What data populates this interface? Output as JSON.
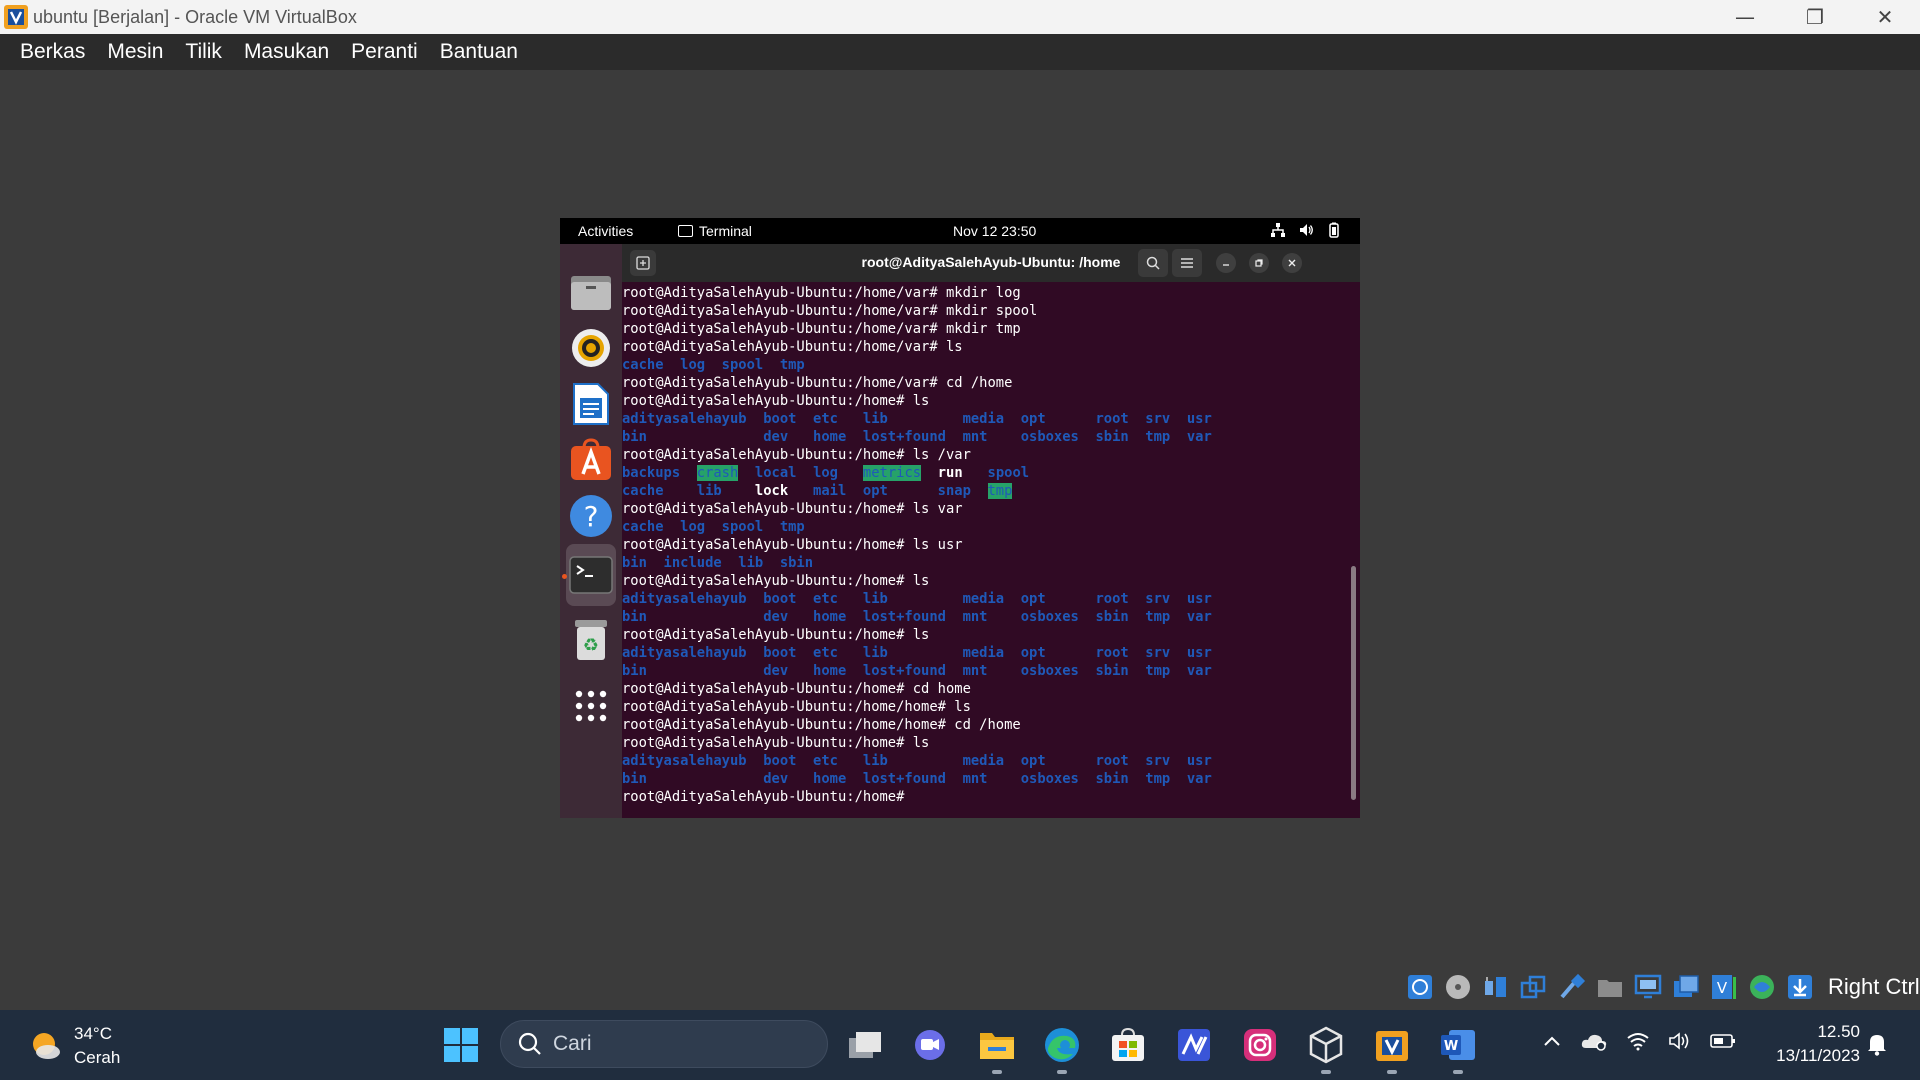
{
  "window": {
    "title": "ubuntu [Berjalan] - Oracle VM VirtualBox",
    "minimize": "—",
    "restore": "❐",
    "close": "✕"
  },
  "menubar": {
    "items": [
      "Berkas",
      "Mesin",
      "Tilik",
      "Masukan",
      "Peranti",
      "Bantuan"
    ]
  },
  "gnome": {
    "activities": "Activities",
    "app_menu": "Terminal",
    "clock": "Nov 12  23:50"
  },
  "terminal": {
    "title": "root@AdityaSalehAyub-Ubuntu: /home",
    "lines": [
      [
        {
          "t": "root@AdityaSalehAyub-Ubuntu:/home/var# mkdir log"
        }
      ],
      [
        {
          "t": "root@AdityaSalehAyub-Ubuntu:/home/var# mkdir spool"
        }
      ],
      [
        {
          "t": "root@AdityaSalehAyub-Ubuntu:/home/var# mkdir tmp"
        }
      ],
      [
        {
          "t": "root@AdityaSalehAyub-Ubuntu:/home/var# ls"
        }
      ],
      [
        {
          "t": "cache  log  spool  tmp",
          "c": "blue"
        }
      ],
      [
        {
          "t": "root@AdityaSalehAyub-Ubuntu:/home/var# cd /home"
        }
      ],
      [
        {
          "t": "root@AdityaSalehAyub-Ubuntu:/home# ls"
        }
      ],
      [
        {
          "t": "adityasalehayub  boot  etc   lib         media  opt      root  srv  usr",
          "c": "blue"
        }
      ],
      [
        {
          "t": "bin              dev   home  lost+found  mnt    osboxes  sbin  tmp  var",
          "c": "blue"
        }
      ],
      [
        {
          "t": "root@AdityaSalehAyub-Ubuntu:/home# ls /var"
        }
      ],
      [
        {
          "t": "backups  ",
          "c": "blue"
        },
        {
          "t": "crash",
          "c": "hl"
        },
        {
          "t": "  local  log   ",
          "c": "blue"
        },
        {
          "t": "metrics",
          "c": "hl"
        },
        {
          "t": "  ",
          "c": "blue"
        },
        {
          "t": "run",
          "c": "bold"
        },
        {
          "t": "   spool",
          "c": "blue"
        }
      ],
      [
        {
          "t": "cache    lib    ",
          "c": "blue"
        },
        {
          "t": "lock",
          "c": "bold"
        },
        {
          "t": "   mail  opt      snap  ",
          "c": "blue"
        },
        {
          "t": "tmp",
          "c": "hl"
        }
      ],
      [
        {
          "t": "root@AdityaSalehAyub-Ubuntu:/home# ls var"
        }
      ],
      [
        {
          "t": "cache  log  spool  tmp",
          "c": "blue"
        }
      ],
      [
        {
          "t": "root@AdityaSalehAyub-Ubuntu:/home# ls usr"
        }
      ],
      [
        {
          "t": "bin  include  lib  sbin",
          "c": "blue"
        }
      ],
      [
        {
          "t": "root@AdityaSalehAyub-Ubuntu:/home# ls"
        }
      ],
      [
        {
          "t": "adityasalehayub  boot  etc   lib         media  opt      root  srv  usr",
          "c": "blue"
        }
      ],
      [
        {
          "t": "bin              dev   home  lost+found  mnt    osboxes  sbin  tmp  var",
          "c": "blue"
        }
      ],
      [
        {
          "t": "root@AdityaSalehAyub-Ubuntu:/home# ls"
        }
      ],
      [
        {
          "t": "adityasalehayub  boot  etc   lib         media  opt      root  srv  usr",
          "c": "blue"
        }
      ],
      [
        {
          "t": "bin              dev   home  lost+found  mnt    osboxes  sbin  tmp  var",
          "c": "blue"
        }
      ],
      [
        {
          "t": "root@AdityaSalehAyub-Ubuntu:/home# cd home"
        }
      ],
      [
        {
          "t": "root@AdityaSalehAyub-Ubuntu:/home/home# ls"
        }
      ],
      [
        {
          "t": "root@AdityaSalehAyub-Ubuntu:/home/home# cd /home"
        }
      ],
      [
        {
          "t": "root@AdityaSalehAyub-Ubuntu:/home# ls"
        }
      ],
      [
        {
          "t": "adityasalehayub  boot  etc   lib         media  opt      root  srv  usr",
          "c": "blue"
        }
      ],
      [
        {
          "t": "bin              dev   home  lost+found  mnt    osboxes  sbin  tmp  var",
          "c": "blue"
        }
      ],
      [
        {
          "t": "root@AdityaSalehAyub-Ubuntu:/home# "
        }
      ]
    ]
  },
  "dock": {
    "icons": [
      "files-icon",
      "rhythmbox-icon",
      "writer-icon",
      "app-center-icon",
      "help-icon",
      "terminal-icon",
      "trash-icon",
      "show-apps-icon"
    ],
    "active": "terminal-icon"
  },
  "vbox_status": {
    "host_key": "Right Ctrl"
  },
  "taskbar": {
    "weather_temp": "34°C",
    "weather_desc": "Cerah",
    "search_placeholder": "Cari",
    "time": "12.50",
    "date": "13/11/2023"
  },
  "colors": {
    "terminal_bg": "#300a24",
    "dir_blue": "#1f59b8",
    "highlight_green": "#26a269",
    "ubuntu_orange": "#e95420"
  }
}
